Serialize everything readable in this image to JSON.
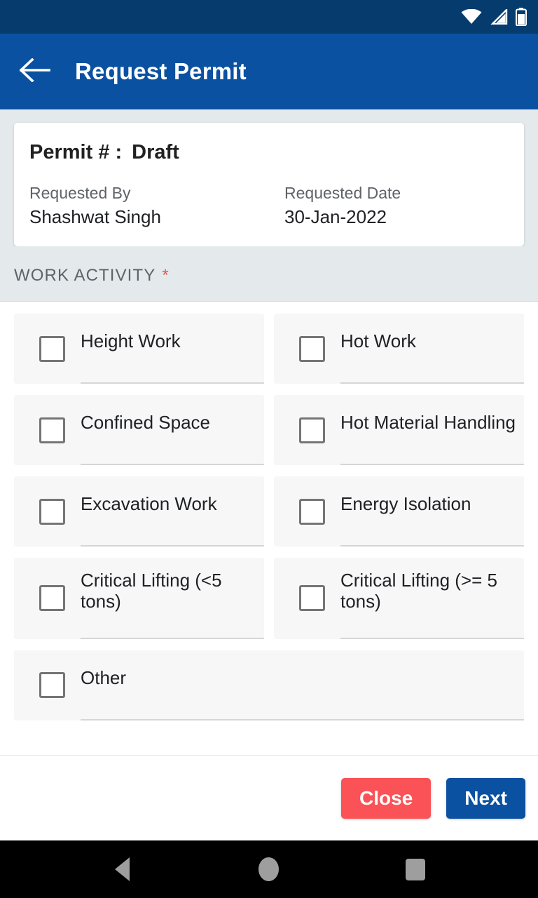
{
  "status_bar": {
    "icons": [
      "wifi-icon",
      "signal-icon",
      "battery-icon"
    ],
    "background_color": "#063b6e"
  },
  "app_bar": {
    "back_icon": "arrow-left-icon",
    "title": "Request Permit",
    "background_color": "#0b51a1",
    "text_color": "#ffffff"
  },
  "permit_card": {
    "permit_label": "Permit # :",
    "permit_value": "Draft",
    "requested_by_label": "Requested By",
    "requested_by_value": "Shashwat Singh",
    "requested_date_label": "Requested Date",
    "requested_date_value": "30-Jan-2022"
  },
  "section": {
    "title": "WORK ACTIVITY",
    "required_marker": "*",
    "required_color": "#f0524d"
  },
  "work_activity": {
    "rows": [
      [
        {
          "label": "Height Work",
          "checked": false
        },
        {
          "label": "Hot Work",
          "checked": false
        }
      ],
      [
        {
          "label": "Confined Space",
          "checked": false
        },
        {
          "label": "Hot Material Handling",
          "checked": false
        }
      ],
      [
        {
          "label": "Excavation Work",
          "checked": false
        },
        {
          "label": "Energy Isolation",
          "checked": false
        }
      ],
      [
        {
          "label": "Critical Lifting (<5 tons)",
          "checked": false
        },
        {
          "label": "Critical Lifting (>= 5 tons)",
          "checked": false
        }
      ],
      [
        {
          "label": "Other",
          "checked": false
        }
      ]
    ]
  },
  "footer": {
    "close_label": "Close",
    "close_color": "#fa5256",
    "next_label": "Next",
    "next_color": "#0b51a1"
  },
  "nav_bar": {
    "back_icon": "triangle-back-icon",
    "home_icon": "circle-home-icon",
    "recents_icon": "square-recents-icon"
  }
}
